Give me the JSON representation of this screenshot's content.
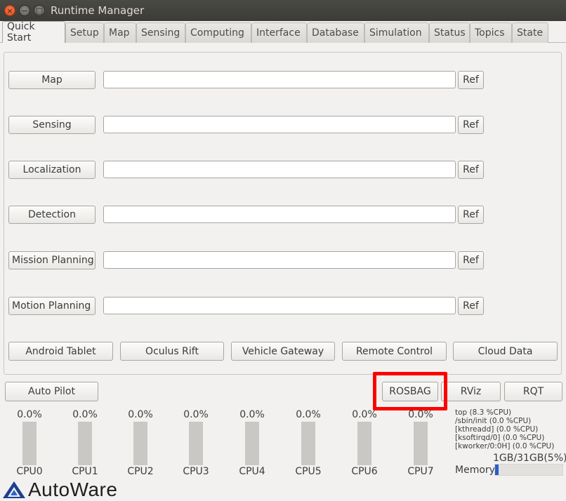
{
  "window": {
    "title": "Runtime Manager",
    "close_glyph": "×",
    "min_glyph": "−",
    "max_glyph": "□"
  },
  "tabs": [
    {
      "label": "Quick Start"
    },
    {
      "label": "Setup"
    },
    {
      "label": "Map"
    },
    {
      "label": "Sensing"
    },
    {
      "label": "Computing"
    },
    {
      "label": "Interface"
    },
    {
      "label": "Database"
    },
    {
      "label": "Simulation"
    },
    {
      "label": "Status"
    },
    {
      "label": "Topics"
    },
    {
      "label": "State"
    }
  ],
  "quick_start": {
    "ref_label": "Ref",
    "rows": [
      {
        "label": "Map",
        "value": ""
      },
      {
        "label": "Sensing",
        "value": ""
      },
      {
        "label": "Localization",
        "value": ""
      },
      {
        "label": "Detection",
        "value": ""
      },
      {
        "label": "Mission Planning",
        "value": ""
      },
      {
        "label": "Motion Planning",
        "value": ""
      }
    ],
    "devices": [
      {
        "label": "Android Tablet"
      },
      {
        "label": "Oculus Rift"
      },
      {
        "label": "Vehicle Gateway"
      },
      {
        "label": "Remote Control"
      },
      {
        "label": "Cloud Data"
      }
    ]
  },
  "bottom_bar": {
    "auto_pilot": "Auto Pilot",
    "rosbag": "ROSBAG",
    "rviz": "RViz",
    "rqt": "RQT"
  },
  "highlight_color": "#ff0000",
  "cpus": [
    {
      "name": "CPU0",
      "percent": "0.0%",
      "level": 0.0
    },
    {
      "name": "CPU1",
      "percent": "0.0%",
      "level": 0.0
    },
    {
      "name": "CPU2",
      "percent": "0.0%",
      "level": 0.0
    },
    {
      "name": "CPU3",
      "percent": "0.0%",
      "level": 0.0
    },
    {
      "name": "CPU4",
      "percent": "0.0%",
      "level": 0.0
    },
    {
      "name": "CPU5",
      "percent": "0.0%",
      "level": 0.0
    },
    {
      "name": "CPU6",
      "percent": "0.0%",
      "level": 0.0
    },
    {
      "name": "CPU7",
      "percent": "0.0%",
      "level": 0.0
    }
  ],
  "processes": [
    "top (8.3 %CPU)",
    "/sbin/init (0.0 %CPU)",
    "[kthreadd] (0.0 %CPU)",
    "[ksoftirqd/0] (0.0 %CPU)",
    "[kworker/0:0H] (0.0 %CPU)"
  ],
  "memory": {
    "label": "Memory",
    "usage": "1GB/31GB(5%)",
    "fraction": 0.05
  },
  "logo": {
    "text": "AutoWare",
    "icon": "autoware-logo-icon"
  }
}
